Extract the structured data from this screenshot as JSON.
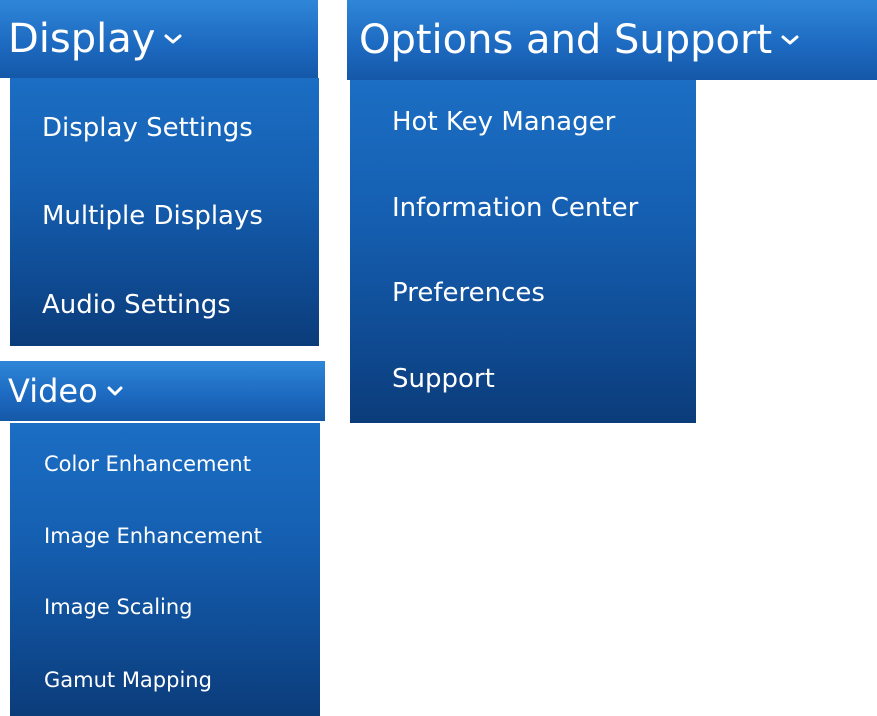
{
  "colors": {
    "header_blue": "#2f86d7",
    "panel_blue_top": "#1b6ec4",
    "panel_blue_bottom": "#0b3c7a",
    "text": "#ffffff"
  },
  "menus": {
    "display": {
      "title": "Display",
      "icon": "chevron-down-icon",
      "items": [
        "Display Settings",
        "Multiple Displays",
        "Audio Settings"
      ]
    },
    "options": {
      "title": "Options and Support",
      "icon": "chevron-down-icon",
      "items": [
        "Hot Key Manager",
        "Information Center",
        "Preferences",
        "Support"
      ]
    },
    "video": {
      "title": "Video",
      "icon": "chevron-down-icon",
      "items": [
        "Color Enhancement",
        "Image Enhancement",
        "Image Scaling",
        "Gamut Mapping"
      ]
    }
  }
}
